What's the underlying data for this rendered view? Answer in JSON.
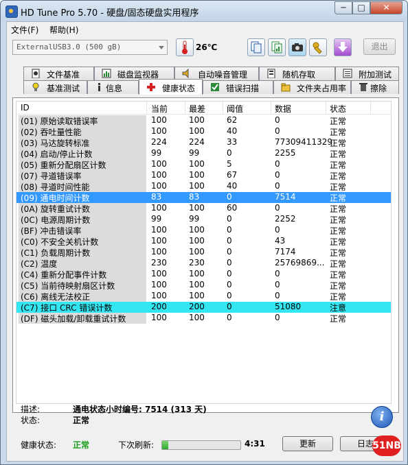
{
  "window": {
    "title": "HD Tune Pro 5.70 - 硬盘/固态硬盘实用程序",
    "min_label": "─",
    "max_label": "□",
    "close_label": "✕"
  },
  "menu": [
    "文件(F)",
    "帮助(H)"
  ],
  "toolbar": {
    "drive": "ExternalUSB3.0 (500 gB)",
    "temperature": "26℃",
    "exit_label": "退出"
  },
  "tabs_top": [
    "文件基准",
    "磁盘监视器",
    "自动噪音管理",
    "随机存取",
    "附加测试"
  ],
  "tabs_bottom": [
    "基准测试",
    "信息",
    "健康状态",
    "错误扫描",
    "文件夹占用率",
    "擦除"
  ],
  "active_tab": "健康状态",
  "table": {
    "headers": [
      "ID",
      "当前",
      "最差",
      "阈值",
      "数据",
      "状态"
    ],
    "rows": [
      {
        "id": "(01) 原始读取错误率",
        "cur": "100",
        "worst": "100",
        "thr": "62",
        "data": "0",
        "status": "正常"
      },
      {
        "id": "(02) 吞吐量性能",
        "cur": "100",
        "worst": "100",
        "thr": "40",
        "data": "0",
        "status": "正常"
      },
      {
        "id": "(03) 马达旋转标准",
        "cur": "224",
        "worst": "224",
        "thr": "33",
        "data": "77309411329",
        "status": "正常"
      },
      {
        "id": "(04) 启动/停止计数",
        "cur": "99",
        "worst": "99",
        "thr": "0",
        "data": "2255",
        "status": "正常"
      },
      {
        "id": "(05) 重新分配扇区计数",
        "cur": "100",
        "worst": "100",
        "thr": "5",
        "data": "0",
        "status": "正常"
      },
      {
        "id": "(07) 寻道错误率",
        "cur": "100",
        "worst": "100",
        "thr": "67",
        "data": "0",
        "status": "正常"
      },
      {
        "id": "(08) 寻道时间性能",
        "cur": "100",
        "worst": "100",
        "thr": "40",
        "data": "0",
        "status": "正常"
      },
      {
        "id": "(09) 通电时间计数",
        "cur": "83",
        "worst": "83",
        "thr": "0",
        "data": "7514",
        "status": "正常"
      },
      {
        "id": "(0A) 旋转重试计数",
        "cur": "100",
        "worst": "100",
        "thr": "60",
        "data": "0",
        "status": "正常"
      },
      {
        "id": "(0C) 电源周期计数",
        "cur": "99",
        "worst": "99",
        "thr": "0",
        "data": "2252",
        "status": "正常"
      },
      {
        "id": "(BF) 冲击错误率",
        "cur": "100",
        "worst": "100",
        "thr": "0",
        "data": "0",
        "status": "正常"
      },
      {
        "id": "(C0) 不安全关机计数",
        "cur": "100",
        "worst": "100",
        "thr": "0",
        "data": "43",
        "status": "正常"
      },
      {
        "id": "(C1) 负载周期计数",
        "cur": "100",
        "worst": "100",
        "thr": "0",
        "data": "7174",
        "status": "正常"
      },
      {
        "id": "(C2) 温度",
        "cur": "230",
        "worst": "230",
        "thr": "0",
        "data": "25769869...",
        "status": "正常"
      },
      {
        "id": "(C4) 重新分配事件计数",
        "cur": "100",
        "worst": "100",
        "thr": "0",
        "data": "0",
        "status": "正常"
      },
      {
        "id": "(C5) 当前待映射扇区计数",
        "cur": "100",
        "worst": "100",
        "thr": "0",
        "data": "0",
        "status": "正常"
      },
      {
        "id": "(C6) 离线无法校正",
        "cur": "100",
        "worst": "100",
        "thr": "0",
        "data": "0",
        "status": "正常"
      },
      {
        "id": "(C7) 接口 CRC 错误计数",
        "cur": "200",
        "worst": "200",
        "thr": "0",
        "data": "51080",
        "status": "注意"
      },
      {
        "id": "(DF) 磁头加载/卸载重试计数",
        "cur": "100",
        "worst": "100",
        "thr": "0",
        "data": "0",
        "status": "正常"
      }
    ]
  },
  "description": {
    "desc_label": "描述:",
    "desc_value": "通电状态小时编号: 7514 (313 天)",
    "status_label": "状态:",
    "status_value": "正常"
  },
  "footer": {
    "health_label": "健康状态:",
    "health_value": "正常",
    "refresh_label": "下次刷新:",
    "refresh_progress": 0.08,
    "countdown": "4:31",
    "update_label": "更新",
    "log_label": "日志",
    "watermark": "51NB"
  },
  "colors": {
    "selected_row": "#3399ff",
    "warning_row": "#33e6f2",
    "health_ok": "#1a9c1a"
  }
}
